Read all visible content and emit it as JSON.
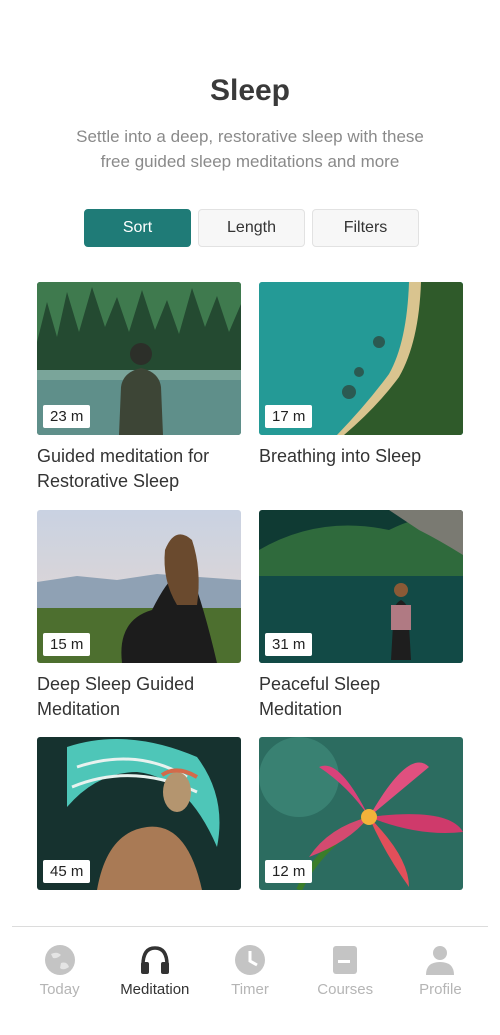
{
  "header": {
    "title": "Sleep",
    "subtitle": "Settle into a deep, restorative sleep with these free guided sleep meditations and more"
  },
  "controls": {
    "sort_label": "Sort",
    "length_label": "Length",
    "filters_label": "Filters"
  },
  "colors": {
    "accent": "#1f7b77",
    "tab_active": "#333333",
    "tab_inactive": "#b5b5b5"
  },
  "cards": [
    {
      "title": "Guided meditation for Restorative Sleep",
      "duration": "23 m"
    },
    {
      "title": "Breathing into Sleep",
      "duration": "17 m"
    },
    {
      "title": "Deep Sleep Guided Meditation",
      "duration": "15 m"
    },
    {
      "title": "Peaceful Sleep Meditation",
      "duration": "31 m"
    },
    {
      "title": "",
      "duration": "45 m"
    },
    {
      "title": "",
      "duration": "12 m"
    }
  ],
  "tabs": [
    {
      "label": "Today",
      "icon": "globe-icon",
      "active": false
    },
    {
      "label": "Meditation",
      "icon": "headphones-icon",
      "active": true
    },
    {
      "label": "Timer",
      "icon": "clock-icon",
      "active": false
    },
    {
      "label": "Courses",
      "icon": "courses-icon",
      "active": false
    },
    {
      "label": "Profile",
      "icon": "person-icon",
      "active": false
    }
  ]
}
